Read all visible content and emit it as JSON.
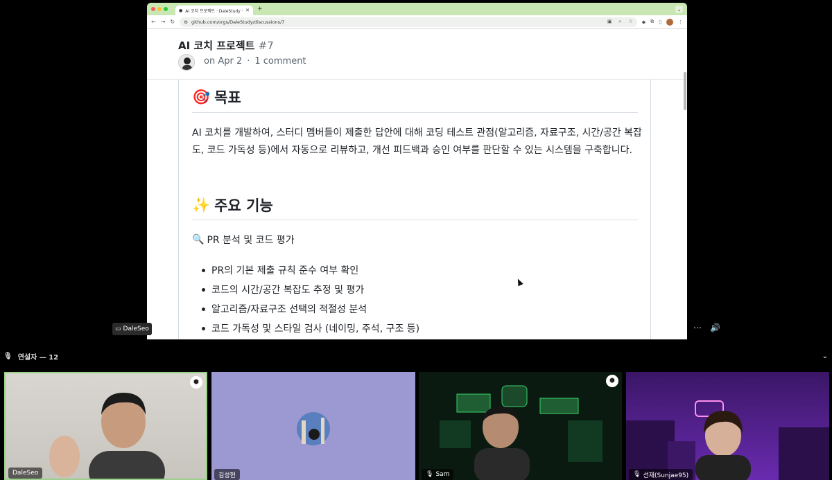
{
  "browser": {
    "tab_title": "AI 코치 프로젝트 · DaleStudy · I",
    "url": "github.com/orgs/DaleStudy/discussions/7"
  },
  "discussion": {
    "title": "AI 코치 프로젝트",
    "number": " #7",
    "date": "on Apr 2",
    "separator": "·",
    "comments": "1 comment"
  },
  "body": {
    "goal_icon": "🎯",
    "goal_heading": "목표",
    "goal_text": "AI 코치를 개발하여, 스터디 멤버들이 제출한 답안에 대해 코딩 테스트 관점(알고리즘, 자료구조, 시간/공간 복잡도, 코드 가독성 등)에서 자동으로 리뷰하고, 개선 피드백과 승인 여부를 판단할 수 있는 시스템을 구축합니다.",
    "features_icon": "✨",
    "features_heading": "주요 기능",
    "sub_icon": "🔍",
    "sub_heading": "PR 분석 및 코드 평가",
    "bullets": [
      "PR의 기본 제출 규칙 준수 여부 확인",
      "코드의 시간/공간 복잡도 추정 및 평가",
      "알고리즘/자료구조 선택의 적절성 분석",
      "코드 가독성 및 스타일 검사 (네이밍, 주석, 구조 등)"
    ]
  },
  "call": {
    "presenter": "DaleSeo",
    "speakers_label": "연설자 — 12"
  },
  "participants": [
    "DaleSeo",
    "김성현",
    "Sam",
    "선재(Sunjae95)"
  ]
}
